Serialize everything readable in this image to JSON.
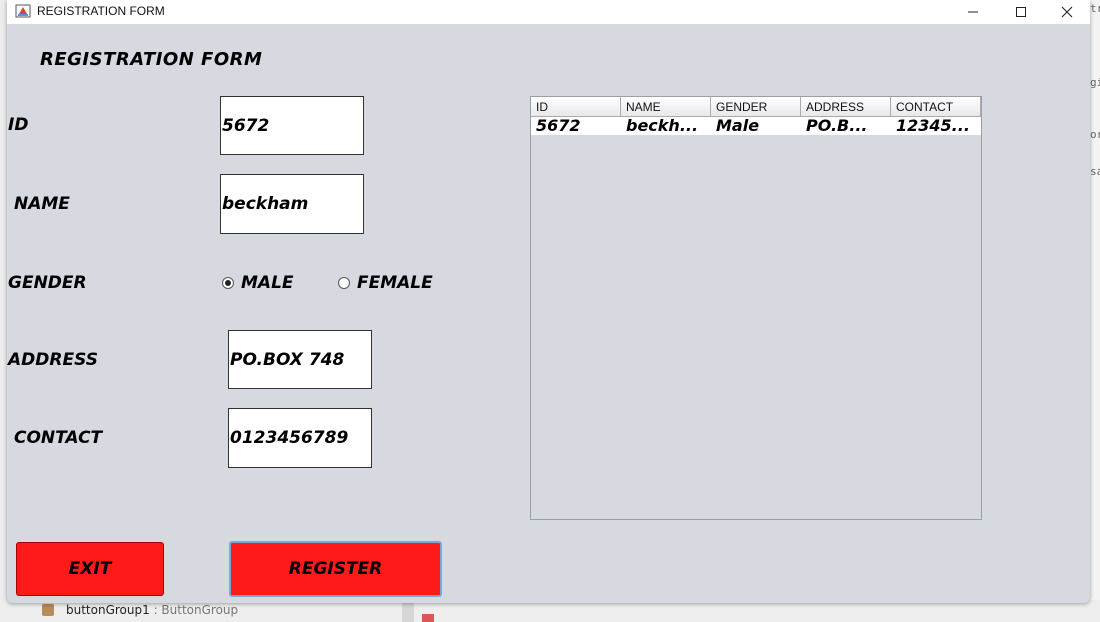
{
  "window": {
    "title": "REGISTRATION FORM",
    "controls": {
      "minimize": "—",
      "maximize": "☐",
      "close": "✕"
    }
  },
  "form": {
    "heading": "REGISTRATION FORM",
    "labels": {
      "id": "ID",
      "name": "NAME",
      "gender": "GENDER",
      "address": "ADDRESS",
      "contact": "CONTACT"
    },
    "values": {
      "id": "5672",
      "name": "beckham",
      "address": "PO.BOX 748",
      "contact": "0123456789"
    },
    "gender_options": [
      {
        "label": "MALE",
        "selected": true
      },
      {
        "label": "FEMALE",
        "selected": false
      }
    ]
  },
  "table": {
    "columns": [
      "ID",
      "NAME",
      "GENDER",
      "ADDRESS",
      "CONTACT"
    ],
    "rows": [
      [
        "5672",
        "beckh...",
        "Male",
        "PO.B...",
        "12345..."
      ]
    ]
  },
  "buttons": {
    "exit": "EXIT",
    "register": "REGISTER"
  },
  "background": {
    "tree_item": "buttonGroup1",
    "tree_item_type": " : ButtonGroup",
    "edge_fragments": [
      "tri",
      "gi",
      "or",
      "sa"
    ]
  },
  "colors": {
    "window_bg": "#d6d9e0",
    "button_red": "#ff1a1a"
  }
}
